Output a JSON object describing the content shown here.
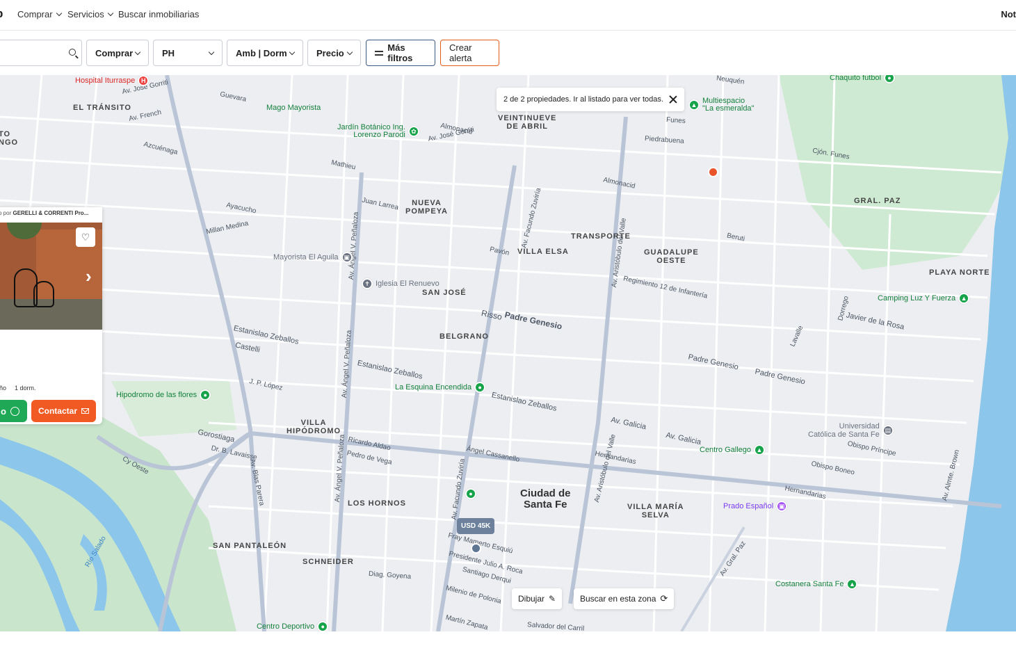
{
  "nav": {
    "logo": "p",
    "items": [
      {
        "label": "Comprar",
        "has_dropdown": true
      },
      {
        "label": "Servicios",
        "has_dropdown": true
      },
      {
        "label": "Buscar inmobiliarias",
        "has_dropdown": false
      }
    ],
    "right_label": "Not"
  },
  "filters": {
    "search_placeholder": "",
    "operation": "Comprar",
    "property_type": "PH",
    "rooms": "Amb | Dorm",
    "price": "Precio",
    "more_filters": "Más filtros",
    "create_alert": "Crear alerta"
  },
  "map": {
    "notice": "2 de 2 propiedades. Ir al listado para ver todas.",
    "price_marker": "USD 45K",
    "draw_button": "Dibujar",
    "search_area_button": "Buscar en esta zona",
    "city_label": "Ciudad de\nSanta Fe",
    "neighborhoods": [
      "EL TRÁNSITO",
      "VEINTINUEVE\nDE ABRIL",
      "NUEVA\nPOMPEYA",
      "GRAL. PAZ",
      "TRANSPORTE",
      "VILLA ELSA",
      "GUADALUPE\nOESTE",
      "PLAYA NORTE",
      "SAN JOSÉ",
      "BELGRANO",
      "VILLA\nHIPÓDROMO",
      "LOS HORNOS",
      "VILLA MARÍA\nSELVA",
      "SAN PANTALEÓN",
      "SCHNEIDER",
      "TO\nNGO"
    ],
    "pois": [
      {
        "label": "Hospital Iturraspe",
        "kind": "hospital"
      },
      {
        "label": "Mago Mayorista",
        "kind": "shop"
      },
      {
        "label": "Jardín Botánico Ing.\nLorenzo Parodi",
        "kind": "park"
      },
      {
        "label": "Multiespacio\n\"La esmeralda\"",
        "kind": "park"
      },
      {
        "label": "Chaquito futbol",
        "kind": "sport"
      },
      {
        "label": "Mayorista El Aguila",
        "kind": "shop"
      },
      {
        "label": "Iglesia El Renuevo",
        "kind": "church"
      },
      {
        "label": "Camping Luz Y Fuerza",
        "kind": "park"
      },
      {
        "label": "La Esquina Encendida",
        "kind": "shop"
      },
      {
        "label": "Hipodromo de las flores",
        "kind": "park"
      },
      {
        "label": "Universidad\nCatólica de Santa Fe",
        "kind": "school"
      },
      {
        "label": "Centro Gallego",
        "kind": "sport"
      },
      {
        "label": "Prado Español",
        "kind": "museum"
      },
      {
        "label": "Costanera Santa Fe",
        "kind": "park"
      },
      {
        "label": "Centro Deportivo",
        "kind": "sport"
      }
    ],
    "streets": [
      "Av. José Gorriti",
      "Av. French",
      "Guevara",
      "Mathieu",
      "Juan Larrea",
      "Azcuénaga",
      "Ayacucho",
      "Pavón",
      "Millan Medina",
      "Javier de la Rosa",
      "Risso",
      "Boneo",
      "Castelli",
      "Estanislao Zeballos",
      "Padre Genesio",
      "Av. Galicia",
      "Gorostiaga",
      "Dr. B. Lavaisse",
      "Av. Blas Parera",
      "Av. Aristóbulo del Valle",
      "Av. Facundo Zuviría",
      "Av. Ángel V. Peñaloza",
      "Presidente Julio A. Roca",
      "Santiago Derqui",
      "Diag. Goyena",
      "Av. Almte. Brown",
      "Av. Gral. Paz",
      "Río Salado",
      "Cy Oeste",
      "Ángel Cassanello",
      "Ricardo Aldao",
      "Pedro de Vega",
      "Hernandarias",
      "J. P. López",
      "Fray Mamerto Esquiú",
      "Iglesia El Renuevo",
      "Regimiento 12 de Infantería",
      "Salvador del Carril",
      "Milenio de Polonia",
      "Martín Zapata",
      "Piedrabuena",
      "Funes",
      "Cjón. Funes",
      "Neuquén",
      "Almonacid",
      "Beruti",
      "Lavalle",
      "Dorrego",
      "Obispo Boneo",
      "Obispo Príncipe",
      "Estanislao Zeballos"
    ]
  },
  "listing": {
    "publisher_prefix": "o por",
    "publisher_name": "GERELLI & CORRENTI Pro...",
    "features": [
      "año",
      "1 dorm."
    ],
    "whatsapp_label": "o",
    "contact_label": "Contactar"
  },
  "colors": {
    "accent_orange": "#f15a22",
    "whatsapp_green": "#1fa855",
    "map_water": "#8cc6ea",
    "map_park": "#c7e8c8",
    "marker_blue": "#5e7593",
    "marker_orange": "#e8532a"
  }
}
